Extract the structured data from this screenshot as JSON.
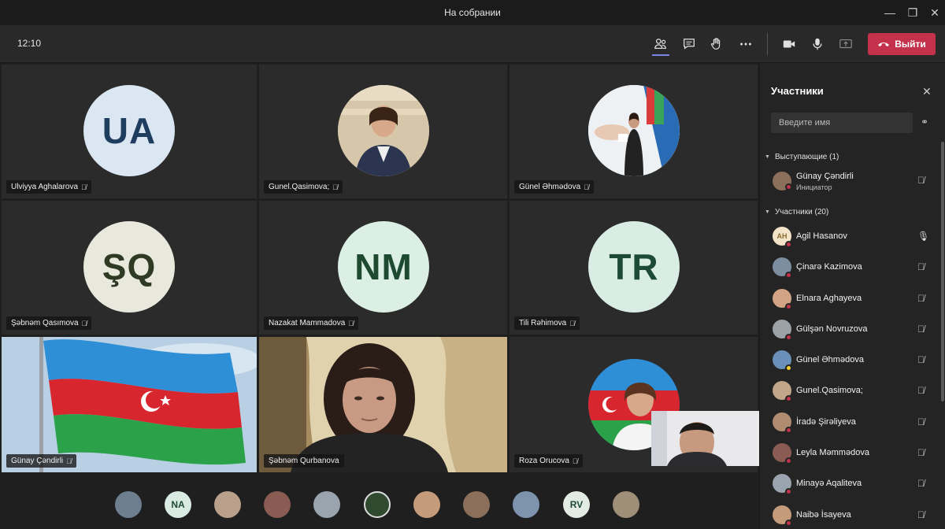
{
  "window": {
    "title": "На собрании"
  },
  "toolbar": {
    "clock": "12:10",
    "leave_label": "Выйти"
  },
  "tiles": [
    {
      "name": "Ulviyya Aghalarova",
      "initials": "UA",
      "kind": "initials",
      "bg": "#dae6f2",
      "fg": "#1f3d5e"
    },
    {
      "name": "Gunel.Qasimova;",
      "initials": "",
      "kind": "photo"
    },
    {
      "name": "Günel Əhmədova",
      "initials": "",
      "kind": "photo"
    },
    {
      "name": "Şəbnəm Qasımova",
      "initials": "ŞQ",
      "kind": "initials",
      "bg": "#e9e8dc",
      "fg": "#2f3a24"
    },
    {
      "name": "Nazakat Mammadova",
      "initials": "NM",
      "kind": "initials",
      "bg": "#dcefe4",
      "fg": "#1e4a32"
    },
    {
      "name": "Tili Rəhimova",
      "initials": "TR",
      "kind": "initials",
      "bg": "#d9ede4",
      "fg": "#1d4a36"
    },
    {
      "name": "Günay Çəndirli",
      "initials": "",
      "kind": "video"
    },
    {
      "name": "Şəbnəm Qurbanova",
      "initials": "",
      "kind": "video"
    },
    {
      "name": "Roza Orucova",
      "initials": "",
      "kind": "photo"
    }
  ],
  "strip": [
    {
      "initials": "",
      "color": "#6d7f8f"
    },
    {
      "initials": "NA",
      "color": "#d9ebe3"
    },
    {
      "initials": "",
      "color": "#b9a08a"
    },
    {
      "initials": "",
      "color": "#8a5b52"
    },
    {
      "initials": "",
      "color": "#9aa4ae"
    },
    {
      "initials": "",
      "color": "#2f4a2f"
    },
    {
      "initials": "",
      "color": "#c49b7b"
    },
    {
      "initials": "",
      "color": "#8b6f5a"
    },
    {
      "initials": "",
      "color": "#7e93ad"
    },
    {
      "initials": "RV",
      "color": "#e2ece5"
    },
    {
      "initials": "",
      "color": "#a08f78"
    }
  ],
  "panel": {
    "title": "Участники",
    "search_placeholder": "Введите имя",
    "presenters_label": "Выступающие (1)",
    "attendees_label": "Участники (20)",
    "presenter": {
      "name": "Günay Çəndirli",
      "role": "Инициатор"
    },
    "attendees": [
      {
        "name": "Agil Hasanov",
        "initials": "AH",
        "mic": "on"
      },
      {
        "name": "Çinarə Kazimova",
        "initials": "",
        "mic": "off"
      },
      {
        "name": "Elnara Aghayeva",
        "initials": "",
        "mic": "off"
      },
      {
        "name": "Gülşən Novruzova",
        "initials": "",
        "mic": "off"
      },
      {
        "name": "Günel Əhmədova",
        "initials": "",
        "mic": "off"
      },
      {
        "name": "Gunel.Qasimova;",
        "initials": "",
        "mic": "off"
      },
      {
        "name": "İradə Şirəliyeva",
        "initials": "",
        "mic": "off"
      },
      {
        "name": "Leyla Məmmədova",
        "initials": "",
        "mic": "off"
      },
      {
        "name": "Minayə Aqaliteva",
        "initials": "",
        "mic": "off"
      },
      {
        "name": "Naibə İsayeva",
        "initials": "",
        "mic": "off"
      }
    ]
  }
}
